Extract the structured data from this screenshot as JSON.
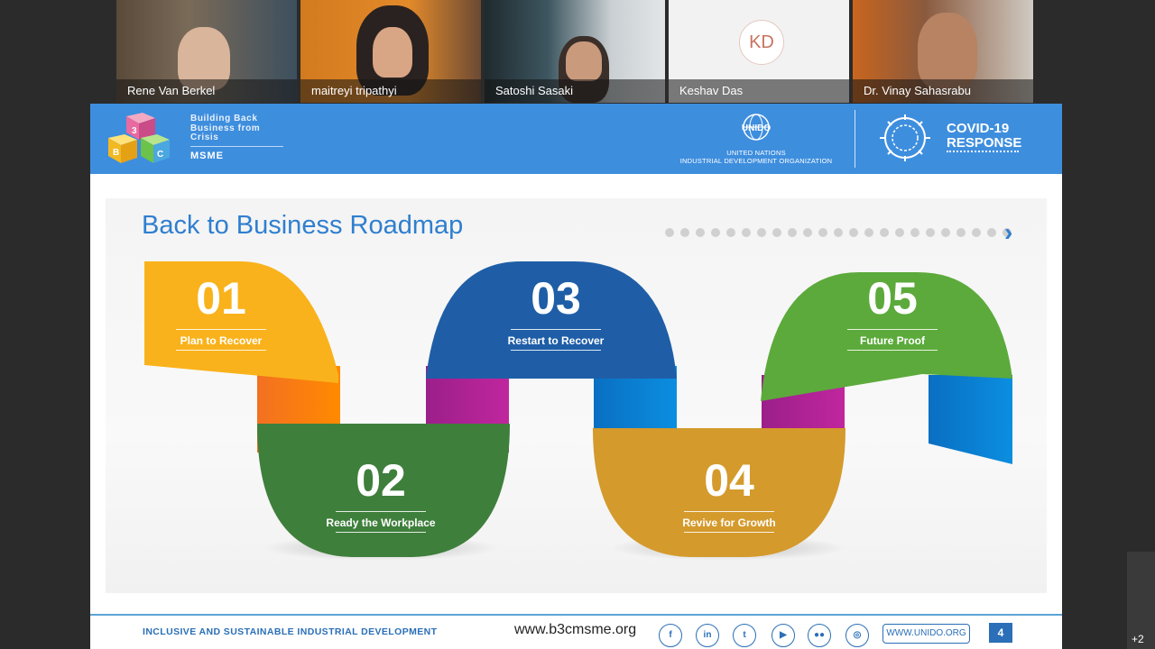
{
  "participants": [
    {
      "name": "Rene Van Berkel",
      "type": "video"
    },
    {
      "name": "maitreyi tripathyi",
      "type": "video"
    },
    {
      "name": "Satoshi Sasaki",
      "type": "video"
    },
    {
      "name": "Keshav Das",
      "type": "avatar",
      "initials": "KD"
    },
    {
      "name": "Dr. Vinay Sahasrabu",
      "type": "video"
    }
  ],
  "overflow_count": "+2",
  "slide": {
    "brand": {
      "line1": "Building Back",
      "line2": "Business from",
      "line3": "Crisis",
      "sub": "MSME",
      "cube_letters": [
        "B",
        "3",
        "C"
      ]
    },
    "unido": {
      "logo_text": "UNIDO",
      "name_line1": "UNITED NATIONS",
      "name_line2": "INDUSTRIAL DEVELOPMENT ORGANIZATION"
    },
    "covid": {
      "line1": "COVID-19",
      "line2": "RESPONSE"
    },
    "title": "Back to Business Roadmap",
    "progress": {
      "total": 23
    },
    "steps": [
      {
        "number": "01",
        "label": "Plan to Recover",
        "color": "#f9b21b"
      },
      {
        "number": "02",
        "label": "Ready the Workplace",
        "color": "#3f7f3c"
      },
      {
        "number": "03",
        "label": "Restart to Recover",
        "color": "#1f5ea7"
      },
      {
        "number": "04",
        "label": "Revive for Growth",
        "color": "#d49a2c"
      },
      {
        "number": "05",
        "label": "Future Proof",
        "color": "#5caa3b"
      }
    ],
    "footer": {
      "tagline": "INCLUSIVE AND SUSTAINABLE INDUSTRIAL DEVELOPMENT",
      "url": "www.b3cmsme.org",
      "social": [
        "facebook-icon",
        "linkedin-icon",
        "twitter-icon",
        "youtube-icon",
        "flickr-icon",
        "instagram-icon"
      ],
      "unido_url": "WWW.UNIDO.ORG",
      "page_number": "4"
    }
  }
}
